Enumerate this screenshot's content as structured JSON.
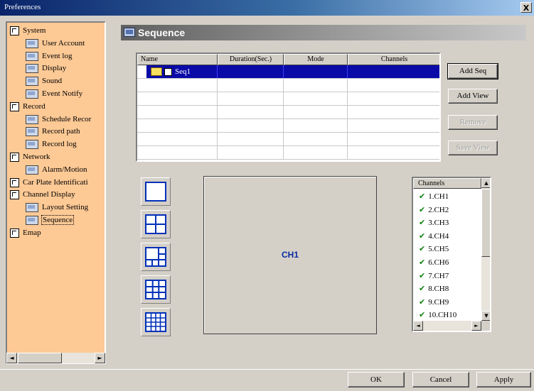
{
  "window": {
    "title": "Preferences",
    "close_glyph": "X"
  },
  "tree": {
    "items": [
      {
        "label": "System",
        "level": 0,
        "icon": "group-icon"
      },
      {
        "label": "User Account",
        "level": 1,
        "icon": "page-icon"
      },
      {
        "label": "Event log",
        "level": 1,
        "icon": "page-icon"
      },
      {
        "label": "Display",
        "level": 1,
        "icon": "page-icon"
      },
      {
        "label": "Sound",
        "level": 1,
        "icon": "page-icon"
      },
      {
        "label": "Event Notify",
        "level": 1,
        "icon": "page-icon"
      },
      {
        "label": "Record",
        "level": 0,
        "icon": "group-icon"
      },
      {
        "label": "Schedule Recor",
        "level": 1,
        "icon": "page-icon"
      },
      {
        "label": "Record path",
        "level": 1,
        "icon": "page-icon"
      },
      {
        "label": "Record log",
        "level": 1,
        "icon": "page-icon"
      },
      {
        "label": "Network",
        "level": 0,
        "icon": "group-icon"
      },
      {
        "label": "Alarm/Motion",
        "level": 1,
        "icon": "page-icon"
      },
      {
        "label": "Car Plate Identificati",
        "level": 0,
        "icon": "group-icon"
      },
      {
        "label": "Channel Display",
        "level": 0,
        "icon": "group-icon"
      },
      {
        "label": "Layout Setting",
        "level": 1,
        "icon": "page-icon"
      },
      {
        "label": "Sequence",
        "level": 1,
        "icon": "page-icon",
        "selected": true
      },
      {
        "label": "Emap",
        "level": 0,
        "icon": "group-icon"
      }
    ],
    "scroll_left_glyph": "◄",
    "scroll_right_glyph": "►"
  },
  "section": {
    "title": "Sequence",
    "icon": "sequence-icon"
  },
  "seq_table": {
    "columns": [
      "Name",
      "Duration(Sec.)",
      "Mode",
      "Channels"
    ],
    "rows": [
      {
        "name": "Seq1",
        "duration": "",
        "mode": "",
        "channels": ""
      }
    ],
    "empty_row_count": 6
  },
  "buttons": {
    "add_seq": "Add Seq",
    "add_view": "Add View",
    "remove": "Remove",
    "save_view": "Save View",
    "ok": "OK",
    "cancel": "Cancel",
    "apply": "Apply"
  },
  "layouts": [
    {
      "name": "layout-1x1-icon",
      "grid": 1
    },
    {
      "name": "layout-2x2-icon",
      "grid": 2
    },
    {
      "name": "layout-1plus5-icon",
      "grid": 3
    },
    {
      "name": "layout-3x3-icon",
      "grid": 3
    },
    {
      "name": "layout-4x4-icon",
      "grid": 4
    }
  ],
  "preview": {
    "label": "CH1"
  },
  "channels": {
    "header": "Channels",
    "items": [
      "1.CH1",
      "2.CH2",
      "3.CH3",
      "4.CH4",
      "5.CH5",
      "6.CH6",
      "7.CH7",
      "8.CH8",
      "9.CH9",
      "10.CH10"
    ],
    "check_glyph": "✔",
    "up_glyph": "▲",
    "down_glyph": "▼",
    "left_glyph": "◄",
    "right_glyph": "►"
  },
  "colors": {
    "tree_bg": "#fdc995",
    "selection": "#0a0aa8",
    "layout_blue": "#0030b8",
    "check_green": "#108010"
  }
}
